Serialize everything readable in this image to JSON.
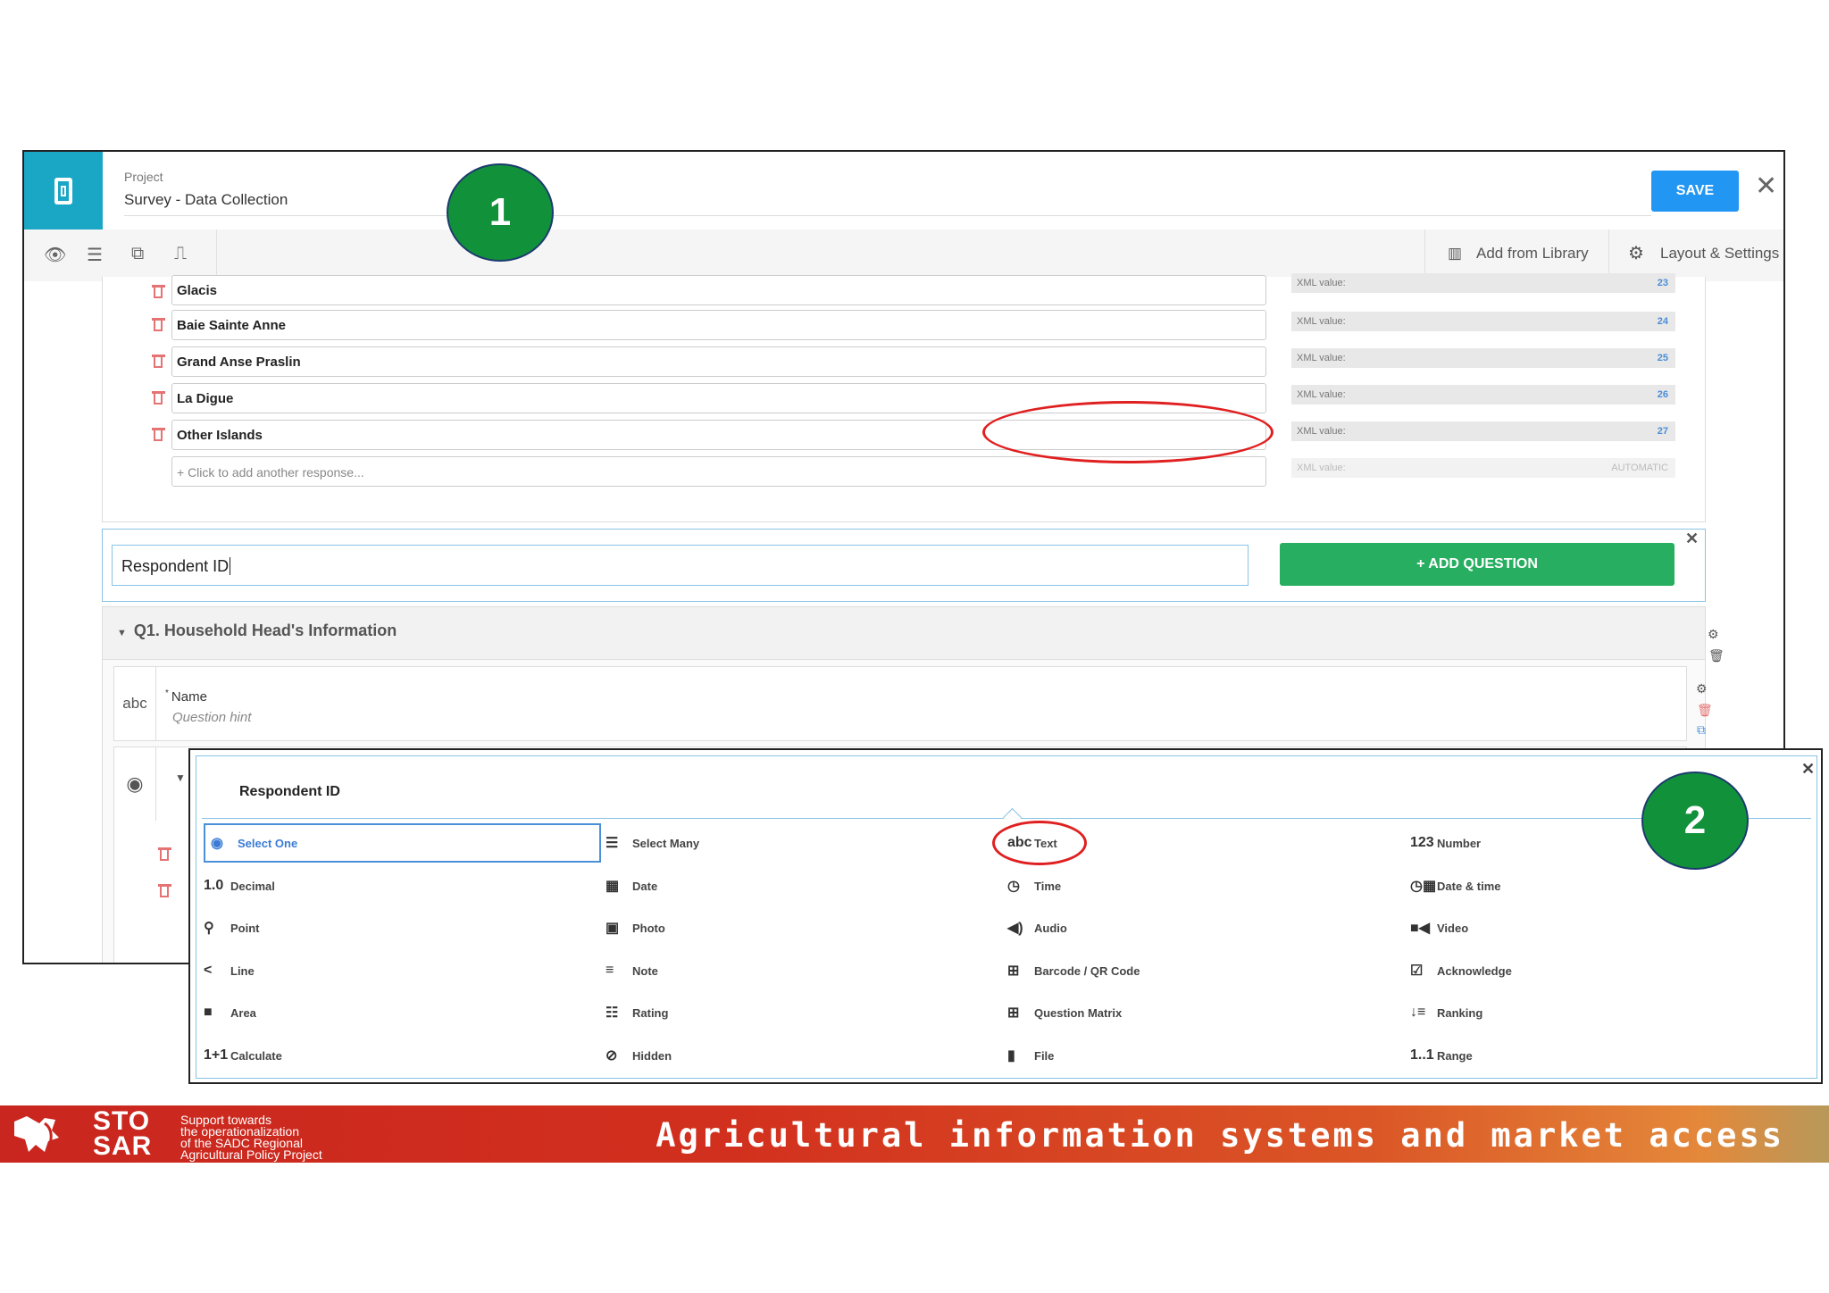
{
  "header": {
    "project_label": "Project",
    "project_name": "Survey - Data Collection",
    "save_label": "SAVE"
  },
  "toolbar": {
    "add_from_library": "Add from Library",
    "layout_settings": "Layout & Settings"
  },
  "choices": [
    {
      "label": "Glacis",
      "xml_label": "XML value:",
      "xml_value": "23"
    },
    {
      "label": "Baie Sainte Anne",
      "xml_label": "XML value:",
      "xml_value": "24"
    },
    {
      "label": "Grand Anse Praslin",
      "xml_label": "XML value:",
      "xml_value": "25"
    },
    {
      "label": "La Digue",
      "xml_label": "XML value:",
      "xml_value": "26"
    },
    {
      "label": "Other Islands",
      "xml_label": "XML value:",
      "xml_value": "27"
    }
  ],
  "add_response": {
    "placeholder": "+ Click to add another response...",
    "xml_label": "XML value:",
    "xml_value": "AUTOMATIC"
  },
  "add_question": {
    "input_value": "Respondent ID",
    "button_label": "+ ADD QUESTION"
  },
  "group": {
    "title": "Q1. Household Head's Information",
    "question": {
      "type_label": "abc",
      "required_mark": "*",
      "name": "Name",
      "hint": "Question hint"
    }
  },
  "popup": {
    "title": "Respondent ID",
    "types": [
      {
        "icon": "◉",
        "label": "Select One"
      },
      {
        "icon": "☰",
        "label": "Select Many"
      },
      {
        "icon": "abc",
        "label": "Text"
      },
      {
        "icon": "123",
        "label": "Number"
      },
      {
        "icon": "1.0",
        "label": "Decimal"
      },
      {
        "icon": "▦",
        "label": "Date"
      },
      {
        "icon": "◷",
        "label": "Time"
      },
      {
        "icon": "◷▦",
        "label": "Date & time"
      },
      {
        "icon": "⚲",
        "label": "Point"
      },
      {
        "icon": "▣",
        "label": "Photo"
      },
      {
        "icon": "◀)",
        "label": "Audio"
      },
      {
        "icon": "■◀",
        "label": "Video"
      },
      {
        "icon": "<",
        "label": "Line"
      },
      {
        "icon": "≡",
        "label": "Note"
      },
      {
        "icon": "⊞",
        "label": "Barcode / QR Code"
      },
      {
        "icon": "☑",
        "label": "Acknowledge"
      },
      {
        "icon": "■",
        "label": "Area"
      },
      {
        "icon": "☷",
        "label": "Rating"
      },
      {
        "icon": "⊞",
        "label": "Question Matrix"
      },
      {
        "icon": "↓≡",
        "label": "Ranking"
      },
      {
        "icon": "1+1",
        "label": "Calculate"
      },
      {
        "icon": "⊘",
        "label": "Hidden"
      },
      {
        "icon": "▮",
        "label": "File"
      },
      {
        "icon": "1..1",
        "label": "Range"
      }
    ]
  },
  "callouts": [
    "1",
    "2"
  ],
  "banner": {
    "brand_top": "STO",
    "brand_bottom": "SAR",
    "tagline_lines": [
      "Support towards",
      "the operationalization",
      "of the SADC Regional",
      "Agricultural Policy Project"
    ],
    "title": "Agricultural information systems and market access"
  },
  "colors": {
    "accent_teal": "#1aa7c6",
    "save_blue": "#2196f3",
    "add_green": "#27ae60",
    "callout_green": "#11923a",
    "highlight_red": "#e02020",
    "banner_red": "#c9261f"
  }
}
